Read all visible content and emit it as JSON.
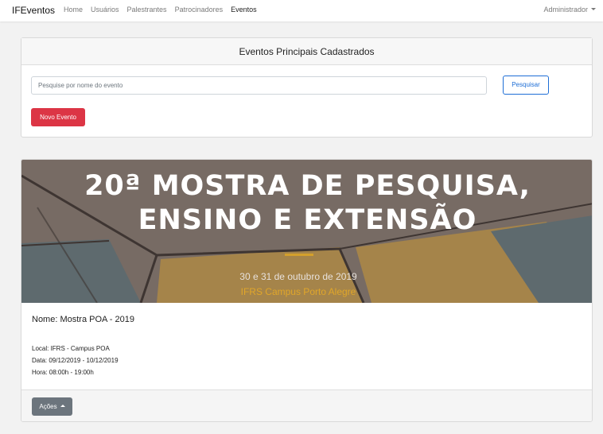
{
  "navbar": {
    "brand": "IFEventos",
    "links": [
      "Home",
      "Usuários",
      "Palestrantes",
      "Patrocinadores",
      "Eventos"
    ],
    "active_link": "Eventos",
    "user_menu": "Administrador"
  },
  "search_card": {
    "title": "Eventos Principais Cadastrados",
    "search_placeholder": "Pesquise por nome do evento",
    "search_button": "Pesquisar",
    "new_event_button": "Novo Evento"
  },
  "event": {
    "banner": {
      "title_line1": "20ª MOSTRA DE PESQUISA,",
      "title_line2": "ENSINO E EXTENSÃO",
      "date_text": "30 e 31 de outubro de 2019",
      "campus_text": "IFRS Campus Porto Alegre"
    },
    "name": "Nome: Mostra POA - 2019",
    "local": "Local: IFRS - Campus POA",
    "date": "Data: 09/12/2019 - 10/12/2019",
    "hours": "Hora: 08:00h - 19:00h",
    "actions_button": "Ações"
  },
  "colors": {
    "danger": "#dc3545",
    "primary": "#1e6ed6",
    "secondary": "#6c757d",
    "banner_background": "#776b64",
    "banner_accent": "#d4a02c"
  },
  "icons": {
    "user_menu_caret": "chevron-down-icon",
    "actions_caret": "chevron-up-icon"
  }
}
